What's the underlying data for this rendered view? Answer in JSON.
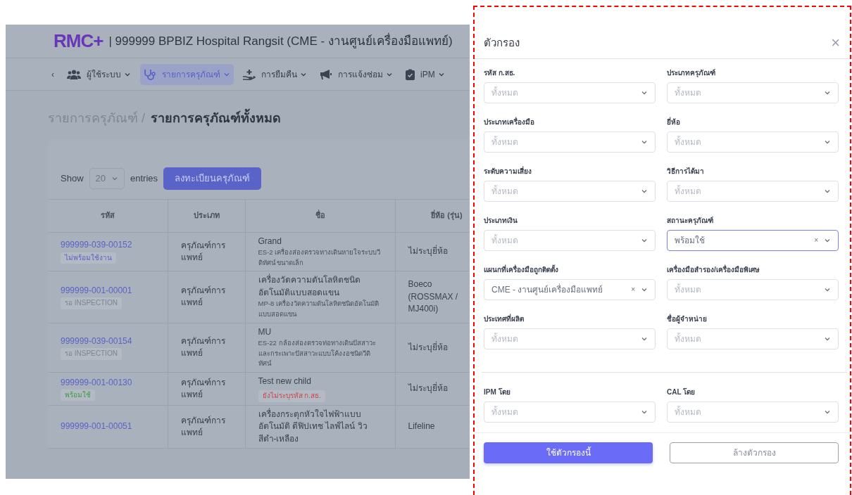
{
  "header": {
    "logo": "RMC+",
    "title": "| 999999 BPBIZ Hospital Rangsit (CME - งานศูนย์เครื่องมือแพทย์)"
  },
  "nav": {
    "back": "‹",
    "items": [
      {
        "label": "ผู้ใช้ระบบ",
        "selected": false
      },
      {
        "label": "รายการครุภัณฑ์",
        "selected": true
      },
      {
        "label": "การยืมคืน",
        "selected": false
      },
      {
        "label": "การแจ้งซ่อม",
        "selected": false
      },
      {
        "label": "iPM",
        "selected": false
      }
    ]
  },
  "breadcrumb": {
    "parent": "รายการครุภัณฑ์ /",
    "current": "รายการครุภัณฑ์ทั้งหมด"
  },
  "list": {
    "show_label": "Show",
    "page_size": "20",
    "entries_label": "entries",
    "register_button": "ลงทะเบียนครุภัณฑ์"
  },
  "table": {
    "columns": [
      "รหัส",
      "ประเภท",
      "ชื่อ",
      "ยี่ห้อ (รุ่น)"
    ],
    "rows": [
      {
        "code": "999999-039-00152",
        "status": {
          "text": "ไม่พร้อมใช้งาน",
          "color": "#5a63c8"
        },
        "type": "ครุภัณฑ์การแพทย์",
        "name": "Grand",
        "detail": "ES-2 เครื่องส่องตรวจทางเดินหายใจระบบวีดิทัศน์ ขนาดเล็ก",
        "brand": "ไม่ระบุยี่ห้อ"
      },
      {
        "code": "999999-001-00001",
        "status": {
          "text": "รอ INSPECTION",
          "color": "#7d8592"
        },
        "type": "ครุภัณฑ์การแพทย์",
        "name": "เครื่องวัดความดันโลหิตชนิดอัตโนมัติแบบสอดแขน",
        "detail": "MP-8 เครื่องวัดความดันโลหิตชนิดอัตโนมัติแบบสอดแขน",
        "brand": "Boeco (ROSSMAX / MJ400i)"
      },
      {
        "code": "999999-039-00154",
        "status": {
          "text": "รอ INSPECTION",
          "color": "#7d8592"
        },
        "type": "ครุภัณฑ์การแพทย์",
        "name": "MU",
        "detail": "ES-22 กล้องส่องตรวจท่อทางเดินปัสสาวะและกระเพาะปัสสาวะแบบโค้งงอชนิดวีดิทัศน์",
        "brand": "ไม่ระบุยี่ห้อ"
      },
      {
        "code": "999999-001-00130",
        "status": {
          "text": "พร้อมใช้",
          "color": "#3f9c4a"
        },
        "type": "ครุภัณฑ์การแพทย์",
        "name": "Test new child",
        "warning": "ยังไม่ระบุรหัส ก.สธ.",
        "brand": "ไม่ระบุยี่ห้อ"
      },
      {
        "code": "999999-001-00051",
        "type": "ครุภัณฑ์การแพทย์",
        "name": "เครื่องกระตุกหัวใจไฟฟ้าแบบอัตโนมัติ ดีฟิปเทช ไลฟ์ไลน์ วิว สีดำ-เหลือง",
        "brand": "Lifeline"
      }
    ]
  },
  "filter": {
    "title": "ตัวกรอง",
    "close": "×",
    "fields": [
      {
        "label": "รหัส ก.สธ.",
        "placeholder": "ทั้งหมด",
        "focused": false
      },
      {
        "label": "ประเภทครุภัณฑ์",
        "placeholder": "ทั้งหมด",
        "focused": false
      },
      {
        "label": "ประเภทเครื่องมือ",
        "placeholder": "ทั้งหมด",
        "focused": false
      },
      {
        "label": "ยี่ห้อ",
        "placeholder": "ทั้งหมด",
        "focused": false
      },
      {
        "label": "ระดับความเสี่ยง",
        "placeholder": "ทั้งหมด",
        "focused": false
      },
      {
        "label": "วิธีการได้มา",
        "placeholder": "ทั้งหมด",
        "focused": false
      },
      {
        "label": "ประเภทเงิน",
        "placeholder": "ทั้งหมด",
        "focused": false
      },
      {
        "label": "สถานะครุภัณฑ์",
        "value": "พร้อมใช้",
        "clear": "×",
        "focused": true
      },
      {
        "label": "แผนกที่เครื่องมือถูกติดตั้ง",
        "value": "CME - งานศูนย์เครื่องมือแพทย์",
        "clear": "×",
        "focused": false
      },
      {
        "label": "เครื่องมือสำรอง/เครื่องมือพิเศษ",
        "placeholder": "ทั้งหมด",
        "focused": false
      },
      {
        "label": "ประเทศที่ผลิต",
        "placeholder": "ทั้งหมด",
        "focused": false
      },
      {
        "label": "ชื่อผู้จำหน่าย",
        "placeholder": "ทั้งหมด",
        "focused": false
      }
    ],
    "extra_fields": [
      {
        "label": "IPM โดย",
        "placeholder": "ทั้งหมด",
        "focused": false
      },
      {
        "label": "CAL โดย",
        "placeholder": "ทั้งหมด",
        "focused": false
      }
    ],
    "apply_button": "ใช้ตัวกรองนี้",
    "clear_button": "ล้างตัวกรอง"
  }
}
